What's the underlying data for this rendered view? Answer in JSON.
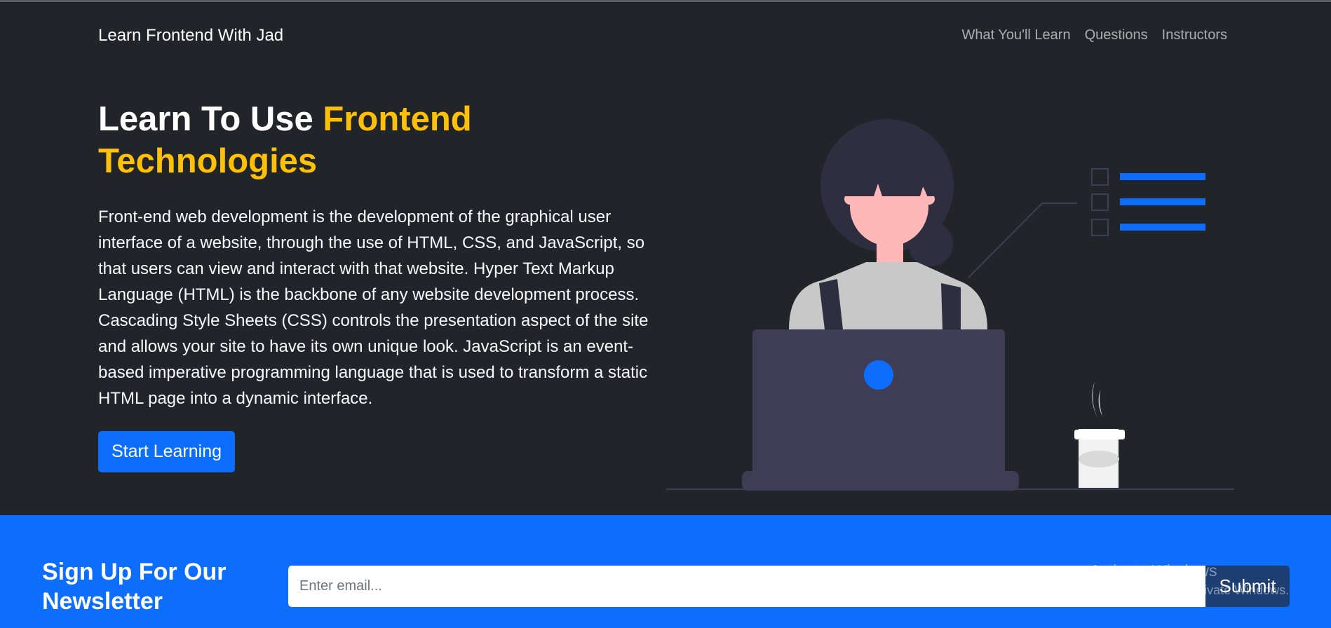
{
  "navbar": {
    "brand": "Learn Frontend With Jad",
    "links": [
      "What You'll Learn",
      "Questions",
      "Instructors"
    ]
  },
  "hero": {
    "title_plain": "Learn To Use ",
    "title_accent": "Frontend Technologies",
    "paragraph": "Front-end web development is the development of the graphical user interface of a website, through the use of HTML, CSS, and JavaScript, so that users can view and interact with that website. Hyper Text Markup Language (HTML) is the backbone of any website development process. Cascading Style Sheets (CSS) controls the presentation aspect of the site and allows your site to have its own unique look. JavaScript is an event-based imperative programming language that is used to transform a static HTML page into a dynamic interface.",
    "button_label": "Start Learning",
    "illustration_icon": "woman-with-laptop-illustration"
  },
  "newsletter": {
    "title": "Sign Up For Our Newsletter",
    "email_placeholder": "Enter email...",
    "email_value": "",
    "submit_label": "Submit"
  },
  "watermark": {
    "line1": "Activate Windows",
    "line2": "Go to Settings to activate Windows."
  },
  "colors": {
    "background": "#212529",
    "accent": "#ffc107",
    "primary": "#0d6efd",
    "submit": "#1d3e70"
  }
}
